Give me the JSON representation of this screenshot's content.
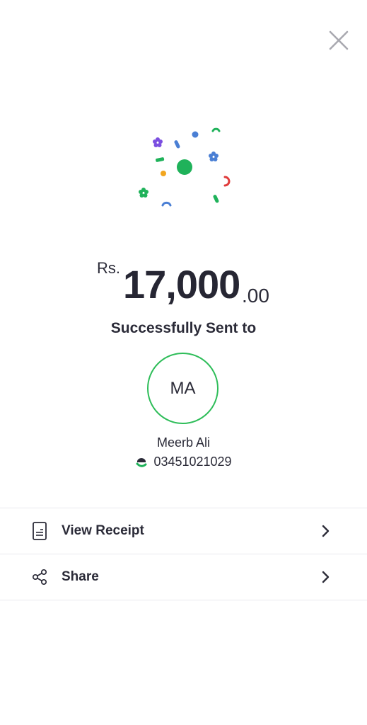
{
  "header": {
    "close_icon": "close-icon"
  },
  "celebration": {
    "icon": "confetti-icon",
    "colors": [
      "#7b4fe0",
      "#4a7fd4",
      "#1fb25a",
      "#f2a61f",
      "#e03c3c"
    ]
  },
  "amount": {
    "currency": "Rs.",
    "whole": "17,000",
    "decimal": ".00"
  },
  "status_text": "Successfully Sent to",
  "recipient": {
    "initials": "MA",
    "name": "Meerb Ali",
    "number": "03451021029",
    "provider_icon": "easypaisa-icon",
    "accent_color": "#2ebd59"
  },
  "actions": [
    {
      "label": "View Receipt",
      "icon": "receipt-icon"
    },
    {
      "label": "Share",
      "icon": "share-icon"
    }
  ]
}
